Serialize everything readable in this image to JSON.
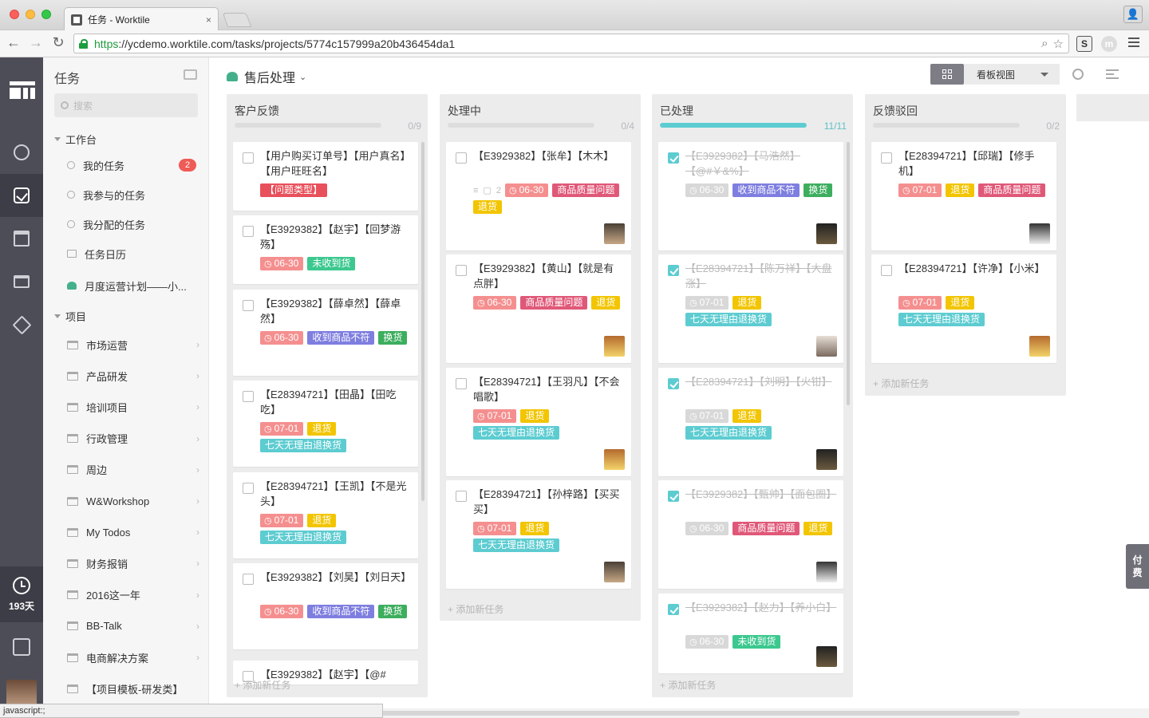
{
  "browser": {
    "tab_title": "任务 - Worktile",
    "tab_close": "×",
    "url_scheme": "https",
    "url_rest": "://ycdemo.worktile.com/tasks/projects/5774c157999a20b436454da1",
    "back": "←",
    "forward": "→",
    "reload": "↻",
    "ext_s": "S",
    "ext_m": "m",
    "status_text": "javascript:;"
  },
  "rail": {
    "days_label": "193天"
  },
  "sidebar": {
    "title": "任务",
    "search_placeholder": "搜索",
    "workbench_label": "工作台",
    "workbench_items": [
      {
        "label": "我的任务",
        "badge": "2"
      },
      {
        "label": "我参与的任务"
      },
      {
        "label": "我分配的任务"
      },
      {
        "label": "任务日历"
      },
      {
        "label": "月度运营计划——小..."
      }
    ],
    "projects_label": "项目",
    "projects": [
      "市场运营",
      "产品研发",
      "培训项目",
      "行政管理",
      "周边",
      "W&Workshop",
      "My Todos",
      "财务报销",
      "2016这一年",
      "BB-Talk",
      "电商解决方案",
      "【项目模板-研发类】"
    ]
  },
  "header": {
    "project_name": "售后处理",
    "project_caret": "⌄",
    "view_label": "看板视图"
  },
  "side_tab": {
    "line1": "付",
    "line2": "费"
  },
  "colors": {
    "red_date": "#f58f8f",
    "teal": "#5dccd1",
    "yellow": "#f2c500",
    "crimson": "#e05878",
    "purple": "#7e7ee0",
    "green": "#3cc88f",
    "gray_date": "#d8d8d8"
  },
  "board": {
    "add_task_label": "添加新任务",
    "columns": [
      {
        "name": "客户反馈",
        "count": "0/9",
        "progress": 0,
        "cards": [
          {
            "text": "【用户购买订单号】【用户真名】【用户旺旺名】",
            "tags": [
              {
                "text": "【问题类型】",
                "color": "#e8505b"
              }
            ]
          },
          {
            "text": "【E3929382】【赵宇】【回梦游殇】",
            "tags": [
              {
                "text": "06-30",
                "color": "#f58f8f",
                "date": true
              },
              {
                "text": "未收到货",
                "color": "#3cc88f"
              }
            ]
          },
          {
            "text": "【E3929382】【薛卓然】【薛卓然】",
            "tags": [
              {
                "text": "06-30",
                "color": "#f58f8f",
                "date": true
              },
              {
                "text": "收到商品不符",
                "color": "#7e7ee0"
              },
              {
                "text": "换货",
                "color": "#3cae5e"
              }
            ]
          },
          {
            "text": "【E28394721】【田晶】【田吃吃】",
            "tags": [
              {
                "text": "07-01",
                "color": "#f58f8f",
                "date": true
              },
              {
                "text": "退货",
                "color": "#f2c500"
              },
              {
                "text": "七天无理由退换货",
                "color": "#5dccd1"
              }
            ]
          },
          {
            "text": "【E28394721】【王凯】【不是光头】",
            "tags": [
              {
                "text": "07-01",
                "color": "#f58f8f",
                "date": true
              },
              {
                "text": "退货",
                "color": "#f2c500"
              },
              {
                "text": "七天无理由退换货",
                "color": "#5dccd1"
              }
            ]
          },
          {
            "text": "【E3929382】【刘昊】【刘日天】",
            "tags": [
              {
                "text": "06-30",
                "color": "#f58f8f",
                "date": true
              },
              {
                "text": "收到商品不符",
                "color": "#7e7ee0"
              },
              {
                "text": "换货",
                "color": "#3cae5e"
              }
            ]
          },
          {
            "text": "【E3929382】【赵宇】【@#",
            "tags": []
          }
        ]
      },
      {
        "name": "处理中",
        "count": "0/4",
        "progress": 0,
        "cards": [
          {
            "text": "【E3929382】【张牟】【木木】",
            "comments": "2",
            "tags": [
              {
                "text": "06-30",
                "color": "#f58f8f",
                "date": true
              },
              {
                "text": "商品质量问题",
                "color": "#e05878"
              },
              {
                "text": "退货",
                "color": "#f2c500"
              }
            ]
          },
          {
            "text": "【E3929382】【黄山】【就是有点胖】",
            "tags": [
              {
                "text": "06-30",
                "color": "#f58f8f",
                "date": true
              },
              {
                "text": "商品质量问题",
                "color": "#e05878"
              },
              {
                "text": "退货",
                "color": "#f2c500"
              }
            ]
          },
          {
            "text": "【E28394721】【王羽凡】【不会唱歌】",
            "tags": [
              {
                "text": "07-01",
                "color": "#f58f8f",
                "date": true
              },
              {
                "text": "退货",
                "color": "#f2c500"
              },
              {
                "text": "七天无理由退换货",
                "color": "#5dccd1"
              }
            ]
          },
          {
            "text": "【E28394721】【孙梓路】【买买买】",
            "tags": [
              {
                "text": "07-01",
                "color": "#f58f8f",
                "date": true
              },
              {
                "text": "退货",
                "color": "#f2c500"
              },
              {
                "text": "七天无理由退换货",
                "color": "#5dccd1"
              }
            ]
          }
        ]
      },
      {
        "name": "已处理",
        "count": "11/11",
        "progress": 1,
        "cards": [
          {
            "text": "【E3929382】【马浩然】【@#￥&%】",
            "done": true,
            "tags": [
              {
                "text": "06-30",
                "color": "#d8d8d8",
                "date": true
              },
              {
                "text": "收到商品不符",
                "color": "#7e7ee0"
              },
              {
                "text": "换货",
                "color": "#3cae5e"
              }
            ]
          },
          {
            "text": "【E28394721】【陈万祥】【大盘涨】",
            "done": true,
            "tags": [
              {
                "text": "07-01",
                "color": "#d8d8d8",
                "date": true
              },
              {
                "text": "退货",
                "color": "#f2c500"
              },
              {
                "text": "七天无理由退换货",
                "color": "#5dccd1"
              }
            ]
          },
          {
            "text": "【E28394721】【刘明】【火钳】",
            "done": true,
            "tags": [
              {
                "text": "07-01",
                "color": "#d8d8d8",
                "date": true
              },
              {
                "text": "退货",
                "color": "#f2c500"
              },
              {
                "text": "七天无理由退换货",
                "color": "#5dccd1"
              }
            ]
          },
          {
            "text": "【E3929382】【甄帅】【面包圈】",
            "done": true,
            "tags": [
              {
                "text": "06-30",
                "color": "#d8d8d8",
                "date": true
              },
              {
                "text": "商品质量问题",
                "color": "#e05878"
              },
              {
                "text": "退货",
                "color": "#f2c500"
              }
            ]
          },
          {
            "text": "【E3929382】【赵力】【养小白】",
            "done": true,
            "tags": [
              {
                "text": "06-30",
                "color": "#d8d8d8",
                "date": true
              },
              {
                "text": "未收到货",
                "color": "#3cc88f"
              }
            ]
          }
        ]
      },
      {
        "name": "反馈驳回",
        "count": "0/2",
        "progress": 0,
        "cards": [
          {
            "text": "【E28394721】【邱瑞】【修手机】",
            "tags": [
              {
                "text": "07-01",
                "color": "#f58f8f",
                "date": true
              },
              {
                "text": "退货",
                "color": "#f2c500"
              },
              {
                "text": "商品质量问题",
                "color": "#e05878"
              }
            ]
          },
          {
            "text": "【E28394721】【许净】【小米】",
            "tags": [
              {
                "text": "07-01",
                "color": "#f58f8f",
                "date": true
              },
              {
                "text": "退货",
                "color": "#f2c500"
              },
              {
                "text": "七天无理由退换货",
                "color": "#5dccd1"
              }
            ]
          }
        ]
      }
    ]
  }
}
